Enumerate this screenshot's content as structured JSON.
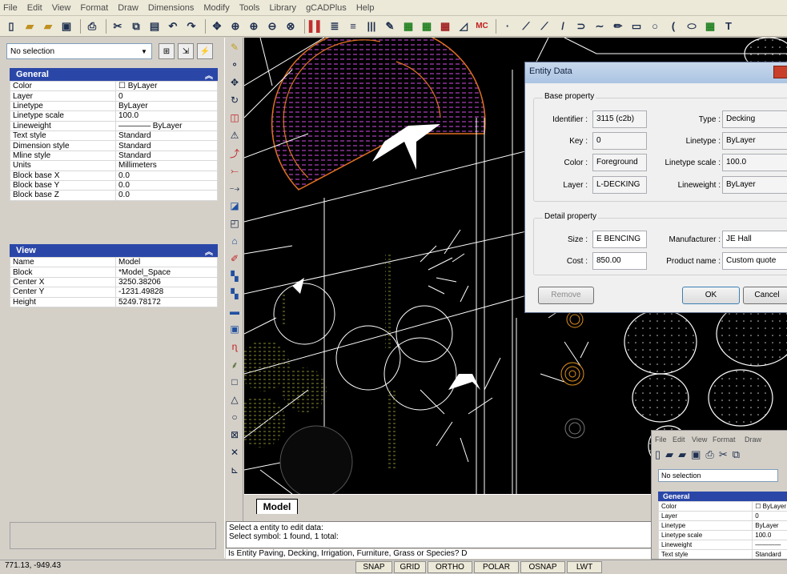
{
  "menu": [
    "File",
    "Edit",
    "View",
    "Format",
    "Draw",
    "Dimensions",
    "Modify",
    "Tools",
    "Library",
    "gCADPlus",
    "Help"
  ],
  "selection": {
    "value": "No selection"
  },
  "general": {
    "title": "General",
    "rows": [
      [
        "Color",
        "☐ ByLayer"
      ],
      [
        "Layer",
        "0"
      ],
      [
        "Linetype",
        "ByLayer"
      ],
      [
        "Linetype scale",
        "100.0"
      ],
      [
        "Lineweight",
        "———— ByLayer"
      ],
      [
        "Text style",
        "Standard"
      ],
      [
        "Dimension style",
        "Standard"
      ],
      [
        "Mline style",
        "Standard"
      ],
      [
        "Units",
        "Millimeters"
      ],
      [
        "Block base X",
        "0.0"
      ],
      [
        "Block base Y",
        "0.0"
      ],
      [
        "Block base Z",
        "0.0"
      ]
    ]
  },
  "view": {
    "title": "View",
    "rows": [
      [
        "Name",
        "Model"
      ],
      [
        "Block",
        "*Model_Space"
      ],
      [
        "Center X",
        "3250.38206"
      ],
      [
        "Center Y",
        "-1231.49828"
      ],
      [
        "Height",
        "5249.78172"
      ]
    ]
  },
  "dialog": {
    "title": "Entity Data",
    "base_label": "Base property",
    "detail_label": "Detail property",
    "identifier_label": "Identifier :",
    "identifier": "3115 (c2b)",
    "type_label": "Type :",
    "type": "Decking",
    "key_label": "Key :",
    "key": "0",
    "linetype_label": "Linetype :",
    "linetype": "ByLayer",
    "color_label": "Color :",
    "color": "Foreground",
    "ltscale_label": "Linetype scale :",
    "ltscale": "100.0",
    "layer_label": "Layer :",
    "layer": "L-DECKING",
    "lweight_label": "Lineweight :",
    "lweight": "ByLayer",
    "size_label": "Size :",
    "size": "E BENCING",
    "mfr_label": "Manufacturer :",
    "mfr": "JE Hall",
    "cost_label": "Cost :",
    "cost": "850.00",
    "product_label": "Product name :",
    "product": "Custom quote",
    "remove": "Remove",
    "ok": "OK",
    "cancel": "Cancel"
  },
  "tab": {
    "model": "Model"
  },
  "command": {
    "line1": "Select a entity to edit data:",
    "line2": "Select symbol: 1 found, 1 total:",
    "prompt": "Is Entity Paving, Decking, Irrigation, Furniture, Grass or Species? D"
  },
  "status": {
    "coords": "771.13, -949.43",
    "buttons": [
      "SNAP",
      "GRID",
      "ORTHO",
      "POLAR",
      "OSNAP",
      "LWT"
    ]
  },
  "mini": {
    "menu": [
      "File",
      "Edit",
      "View",
      "Format",
      "Draw"
    ],
    "selection": "No selection",
    "general": "General",
    "rows": [
      [
        "Color",
        "☐ ByLayer"
      ],
      [
        "Layer",
        "0"
      ],
      [
        "Linetype",
        "ByLayer"
      ],
      [
        "Linetype scale",
        "100.0"
      ],
      [
        "Lineweight",
        "————"
      ],
      [
        "Text style",
        "Standard"
      ]
    ]
  },
  "colors": {
    "section_header": "#2a47a8",
    "canvas": "#000000",
    "hatch": "#b040c0",
    "outline": "#e07020"
  }
}
